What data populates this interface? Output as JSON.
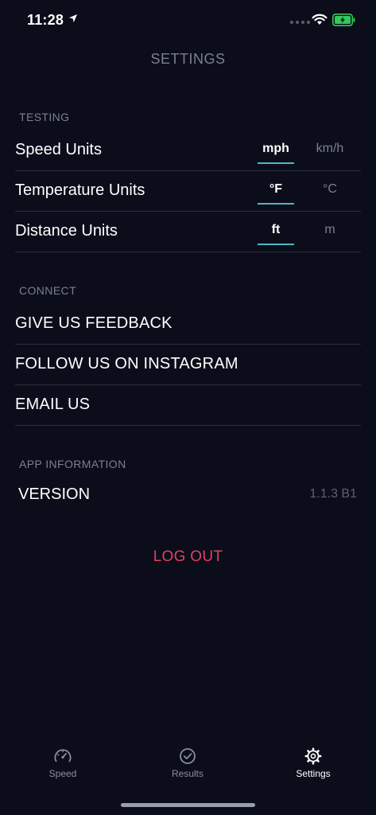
{
  "status_bar": {
    "time": "11:28"
  },
  "header": {
    "title": "SETTINGS"
  },
  "testing": {
    "header": "TESTING",
    "rows": [
      {
        "label": "Speed Units",
        "option_a": "mph",
        "option_b": "km/h",
        "selected": "option_a"
      },
      {
        "label": "Temperature Units",
        "option_a": "°F",
        "option_b": "°C",
        "selected": "option_a"
      },
      {
        "label": "Distance Units",
        "option_a": "ft",
        "option_b": "m",
        "selected": "option_a"
      }
    ]
  },
  "connect": {
    "header": "CONNECT",
    "items": [
      {
        "label": "GIVE US FEEDBACK"
      },
      {
        "label": "FOLLOW US ON INSTAGRAM"
      },
      {
        "label": "EMAIL US"
      }
    ]
  },
  "app_info": {
    "header": "APP INFORMATION",
    "version_label": "VERSION",
    "version_value": "1.1.3 B1"
  },
  "logout_label": "LOG OUT",
  "tabs": [
    {
      "label": "Speed",
      "icon": "speedometer-icon",
      "active": false
    },
    {
      "label": "Results",
      "icon": "check-circle-icon",
      "active": false
    },
    {
      "label": "Settings",
      "icon": "gear-icon",
      "active": true
    }
  ],
  "colors": {
    "background": "#0b0d1a",
    "accent": "#4fb7c6",
    "logout": "#e0405f",
    "battery": "#34c759"
  }
}
